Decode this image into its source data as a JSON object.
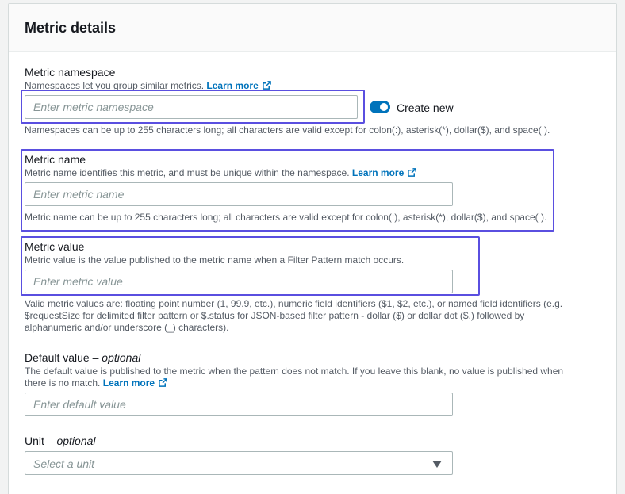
{
  "panel": {
    "title": "Metric details"
  },
  "namespace": {
    "label": "Metric namespace",
    "description": "Namespaces let you group similar metrics.",
    "learn_more": "Learn more",
    "placeholder": "Enter metric namespace",
    "toggle_label": "Create new",
    "toggle_on": true,
    "constraint": "Namespaces can be up to 255 characters long; all characters are valid except for colon(:), asterisk(*), dollar($), and space( )."
  },
  "metric_name": {
    "label": "Metric name",
    "description": "Metric name identifies this metric, and must be unique within the namespace.",
    "learn_more": "Learn more",
    "placeholder": "Enter metric name",
    "constraint": "Metric name can be up to 255 characters long; all characters are valid except for colon(:), asterisk(*), dollar($), and space( )."
  },
  "metric_value": {
    "label": "Metric value",
    "description": "Metric value is the value published to the metric name when a Filter Pattern match occurs.",
    "placeholder": "Enter metric value",
    "constraint_line1": "Valid metric values are: floating point number (1, 99.9, etc.), numeric field identifiers ($1, $2, etc.), or named field identifiers (e.g.",
    "constraint_line2": "$requestSize for delimited filter pattern or $.status for JSON-based filter pattern - dollar ($) or dollar dot ($.) followed by",
    "constraint_line3": "alphanumeric and/or underscore (_) characters)."
  },
  "default_value": {
    "label": "Default value – ",
    "optional": "optional",
    "description_line1": "The default value is published to the metric when the pattern does not match. If you leave this blank, no value is published when",
    "description_line2": "there is no match.",
    "learn_more": "Learn more",
    "placeholder": "Enter default value"
  },
  "unit": {
    "label": "Unit – ",
    "optional": "optional",
    "placeholder": "Select a unit"
  },
  "colors": {
    "link": "#0073bb",
    "highlight": "#5a4fe0",
    "toggle": "#0073bb"
  }
}
